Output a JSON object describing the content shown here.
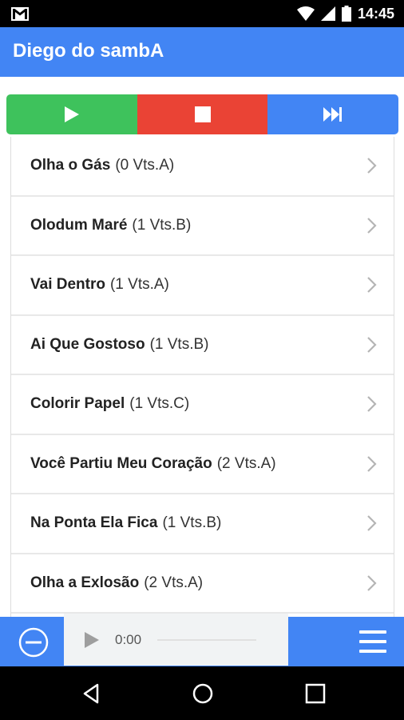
{
  "status_bar": {
    "time": "14:45",
    "icons": [
      "gmail-icon",
      "wifi-icon",
      "signal-icon",
      "battery-icon"
    ]
  },
  "app_bar": {
    "title": "Diego do sambA",
    "color": "#4285f4"
  },
  "controls": {
    "buttons": [
      {
        "icon": "play-icon",
        "color": "#3ec25c"
      },
      {
        "icon": "stop-icon",
        "color": "#ea4335"
      },
      {
        "icon": "skip-next-icon",
        "color": "#4285f4"
      }
    ]
  },
  "songs": [
    {
      "name": "Olha o Gás",
      "votes": "(0 Vts.A)"
    },
    {
      "name": "Olodum Maré",
      "votes": "(1 Vts.B)"
    },
    {
      "name": "Vai Dentro",
      "votes": "(1 Vts.A)"
    },
    {
      "name": "Ai Que Gostoso",
      "votes": "(1 Vts.B)"
    },
    {
      "name": "Colorir Papel",
      "votes": "(1 Vts.C)"
    },
    {
      "name": "Você Partiu Meu Coração",
      "votes": "(2 Vts.A)"
    },
    {
      "name": "Na Ponta Ela Fica",
      "votes": "(1 Vts.B)"
    },
    {
      "name": "Olha a Exlosão",
      "votes": "(2 Vts.A)"
    }
  ],
  "player": {
    "time": "0:00",
    "progress": 0,
    "icons": [
      "minus-circle-icon",
      "audio-play-icon",
      "menu-icon"
    ]
  },
  "nav_bar": {
    "icons": [
      "back-icon",
      "home-icon",
      "recents-icon"
    ]
  }
}
